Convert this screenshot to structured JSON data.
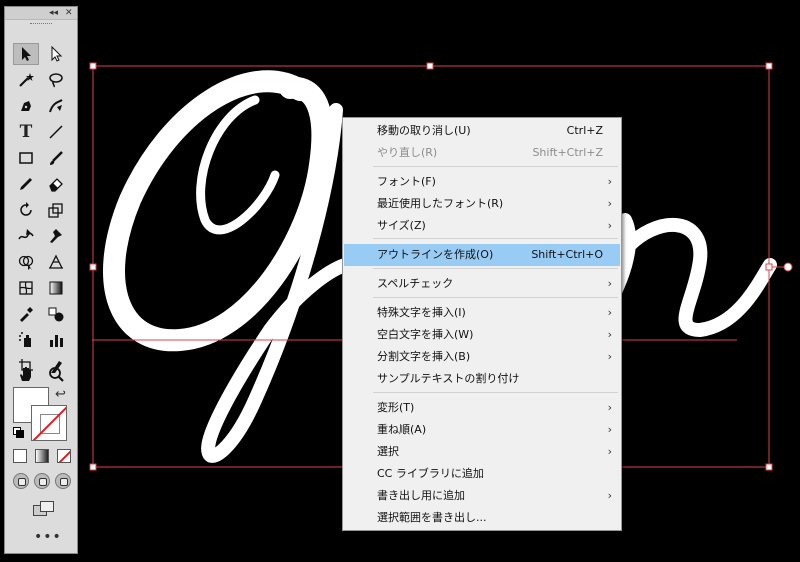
{
  "toolbar": {
    "collapse_label": "◂◂",
    "close_label": "✕",
    "more_label": "•••"
  },
  "context_menu": {
    "items": [
      {
        "label": "移動の取り消し(U)",
        "shortcut": "Ctrl+Z"
      },
      {
        "label": "やり直し(R)",
        "shortcut": "Shift+Ctrl+Z",
        "disabled": true
      },
      {
        "label": "フォント(F)",
        "submenu": true
      },
      {
        "label": "最近使用したフォント(R)",
        "submenu": true
      },
      {
        "label": "サイズ(Z)",
        "submenu": true
      },
      {
        "label": "アウトラインを作成(O)",
        "shortcut": "Shift+Ctrl+O",
        "highlighted": true
      },
      {
        "label": "スペルチェック",
        "submenu": true
      },
      {
        "label": "特殊文字を挿入(I)",
        "submenu": true
      },
      {
        "label": "空白文字を挿入(W)",
        "submenu": true
      },
      {
        "label": "分割文字を挿入(B)",
        "submenu": true
      },
      {
        "label": "サンプルテキストの割り付け"
      },
      {
        "label": "変形(T)",
        "submenu": true
      },
      {
        "label": "重ね順(A)",
        "submenu": true
      },
      {
        "label": "選択",
        "submenu": true
      },
      {
        "label": "CC ライブラリに追加"
      },
      {
        "label": "書き出し用に追加",
        "submenu": true
      },
      {
        "label": "選択範囲を書き出し..."
      }
    ],
    "submenu_arrow": "›"
  },
  "colors": {
    "canvas_bg": "#000000",
    "selection": "#e0404a",
    "highlight": "#99ccf5",
    "fill": "#ffffff",
    "stroke_none": "#e21b1b"
  }
}
